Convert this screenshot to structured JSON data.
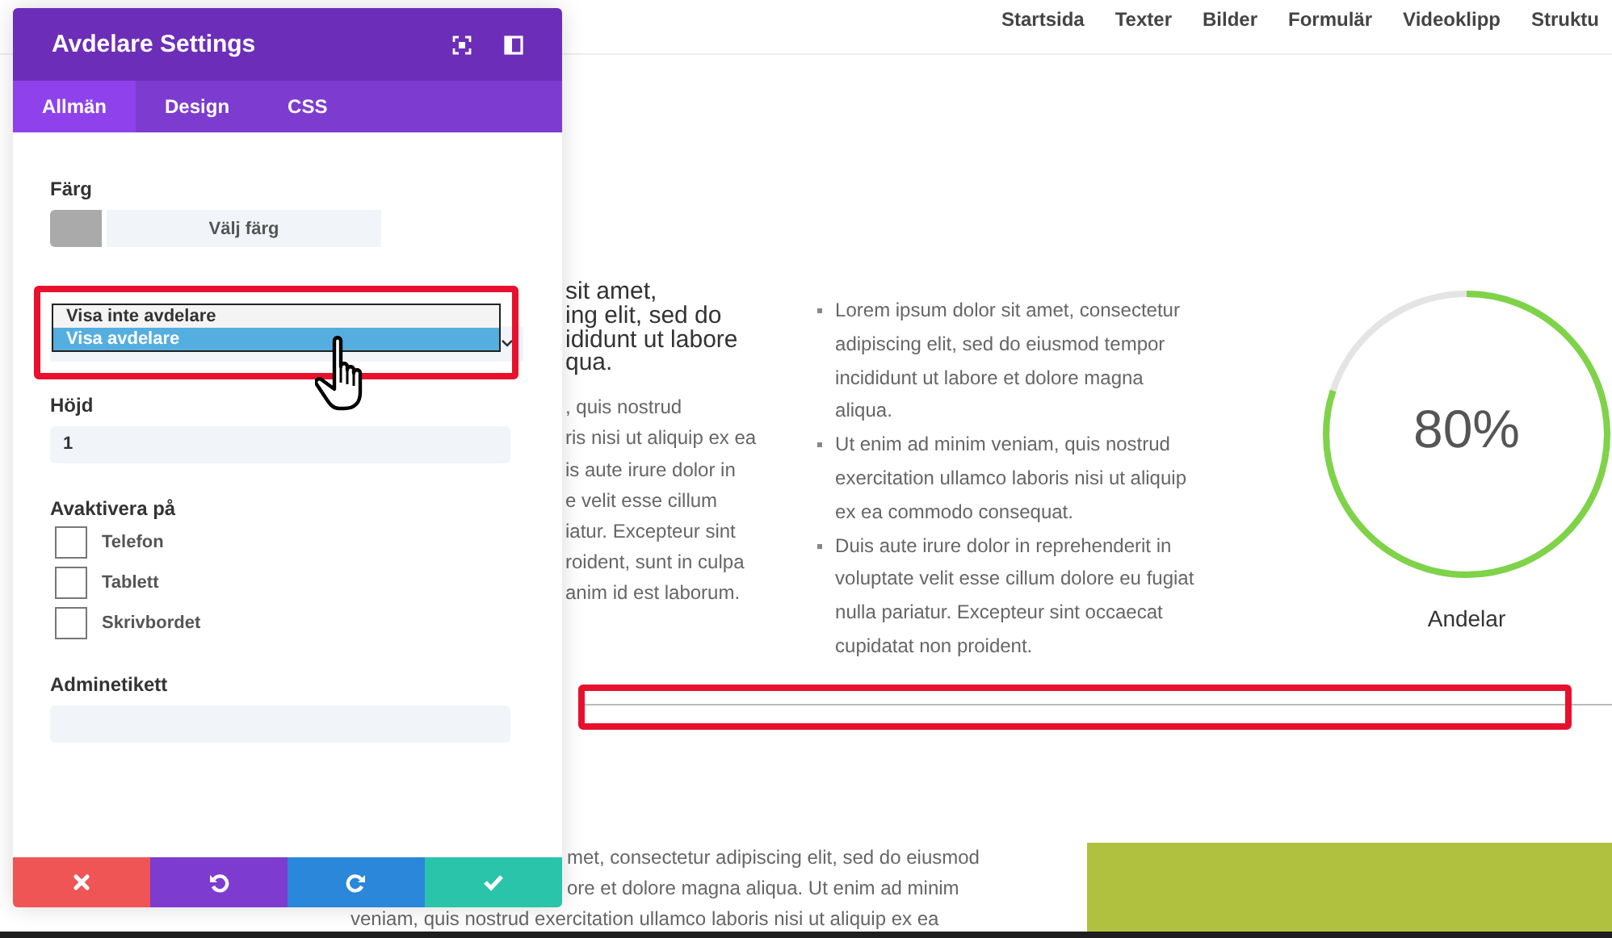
{
  "nav": {
    "items": [
      "Startsida",
      "Texter",
      "Bilder",
      "Formulär",
      "Videoklipp",
      "Struktu"
    ]
  },
  "panel": {
    "title": "Avdelare Settings",
    "tabs": [
      {
        "label": "Allmän",
        "selected": true
      },
      {
        "label": "Design",
        "selected": false
      },
      {
        "label": "CSS",
        "selected": false
      }
    ],
    "color_field": {
      "label": "Färg",
      "color": "#aaaaaa",
      "button": "Välj färg"
    },
    "visibility": {
      "options": [
        {
          "label": "Visa inte avdelare",
          "selected": false
        },
        {
          "label": "Visa avdelare",
          "selected": true
        }
      ]
    },
    "height_field": {
      "label": "Höjd",
      "value": "1"
    },
    "disable_on": {
      "label": "Avaktivera på",
      "options": [
        {
          "label": "Telefon",
          "checked": false
        },
        {
          "label": "Tablett",
          "checked": false
        },
        {
          "label": "Skrivbordet",
          "checked": false
        }
      ]
    },
    "admin_label": {
      "label": "Adminetikett"
    },
    "footer_buttons": [
      {
        "kind": "cancel"
      },
      {
        "kind": "undo"
      },
      {
        "kind": "redo"
      },
      {
        "kind": "save"
      }
    ]
  },
  "content": {
    "heading_lines": [
      "sit amet,",
      "ing elit, sed do",
      "ididunt ut labore",
      "qua."
    ],
    "body_lines": [
      ", quis nostrud",
      "ris nisi ut aliquip ex ea",
      "is aute irure dolor in",
      "e velit esse cillum",
      "iatur. Excepteur sint",
      "roident, sunt in culpa",
      "anim id est laborum."
    ],
    "bullets": [
      "Lorem ipsum dolor sit amet, consectetur adipiscing elit, sed do eiusmod tempor incididunt ut labore et dolore magna aliqua.",
      "Ut enim ad minim veniam, quis nostrud exercitation ullamco laboris nisi ut aliquip ex ea commodo consequat.",
      "Duis aute irure dolor in reprehenderit in voluptate velit esse cillum dolore eu fugiat nulla pariatur. Excepteur sint occaecat cupidatat non proident."
    ],
    "counter": {
      "value": "80%",
      "level": 0.8,
      "label": "Andelar"
    },
    "bottom_lines": [
      "met, consectetur adipiscing elit, sed do eiusmod",
      "ore et dolore magna aliqua. Ut enim ad minim",
      "veniam, quis nostrud exercitation ullamco laboris nisi ut aliquip ex ea"
    ]
  }
}
